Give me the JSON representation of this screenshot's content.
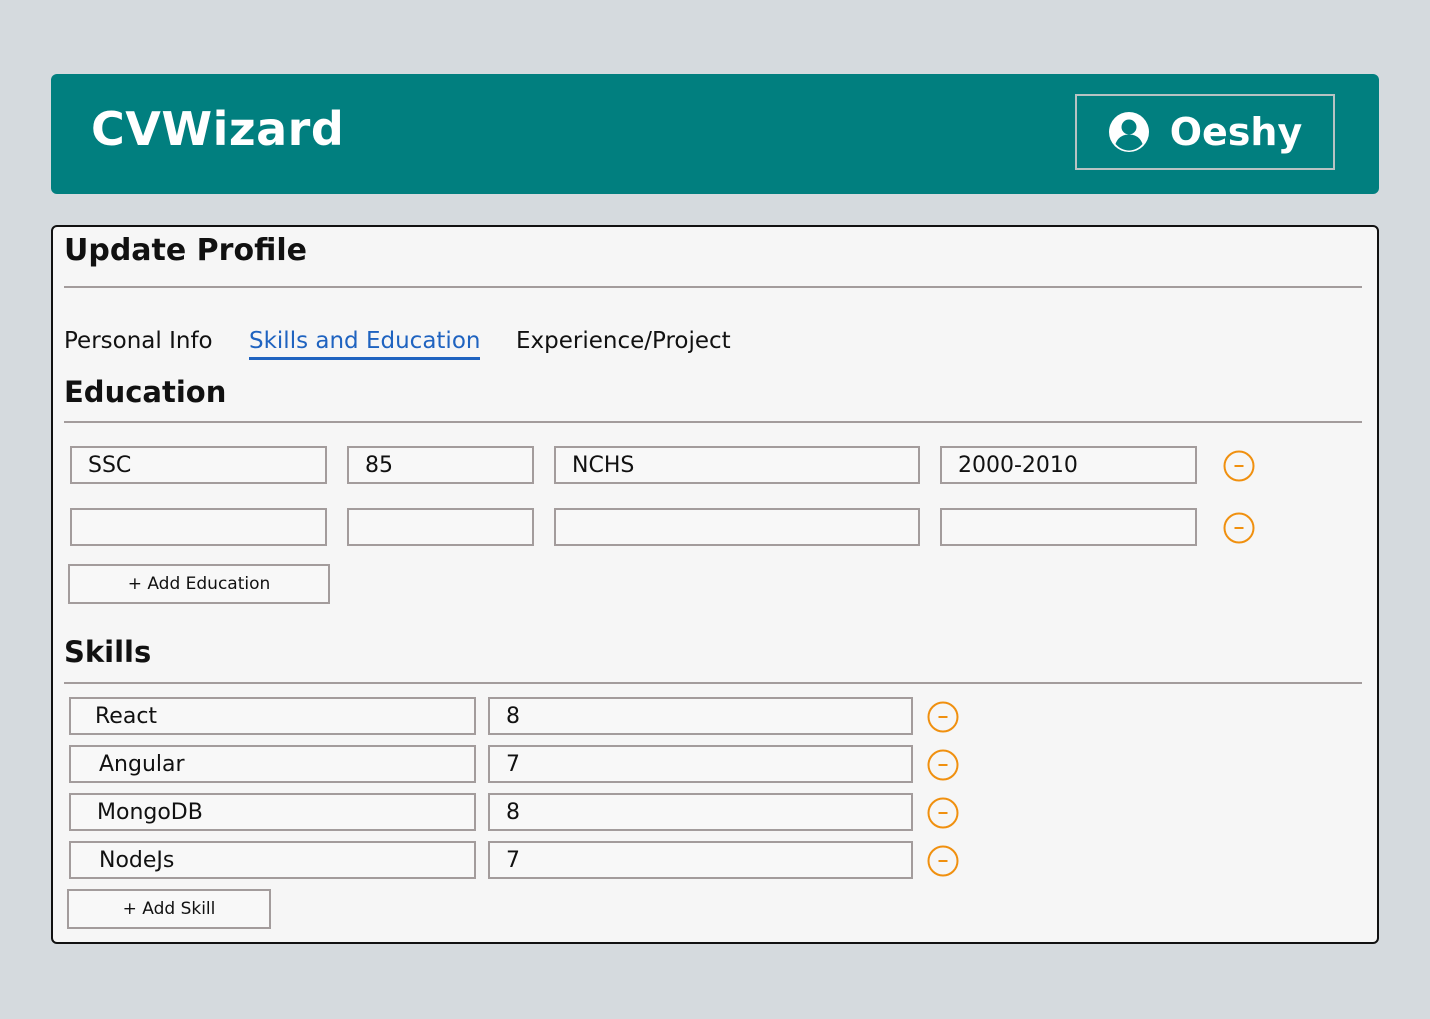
{
  "header": {
    "brand": "CVWizard",
    "user_name": "Oeshy",
    "user_icon": "user-circle-icon"
  },
  "card": {
    "title": "Update Profile",
    "tabs": [
      {
        "label": "Personal Info",
        "active": false
      },
      {
        "label": "Skills and Education",
        "active": true
      },
      {
        "label": "Experience/Project",
        "active": false
      }
    ]
  },
  "education": {
    "title": "Education",
    "rows": [
      {
        "degree": "SSC",
        "score": "85",
        "institute": "NCHS",
        "years": "2000-2010"
      },
      {
        "degree": "",
        "score": "",
        "institute": "",
        "years": ""
      }
    ],
    "add_label": "+ Add Education",
    "remove_icon": "minus-circle-icon"
  },
  "skills": {
    "title": "Skills",
    "rows": [
      {
        "name": "React",
        "level": "8"
      },
      {
        "name": "Angular",
        "level": "7"
      },
      {
        "name": "MongoDB",
        "level": "8"
      },
      {
        "name": "NodeJs",
        "level": "7"
      }
    ],
    "add_label": "+ Add Skill",
    "remove_icon": "minus-circle-icon"
  },
  "colors": {
    "header_bg": "#017f7f",
    "accent_tab": "#1f63c0",
    "remove_icon": "#f0900f",
    "page_bg": "#d5dade"
  }
}
